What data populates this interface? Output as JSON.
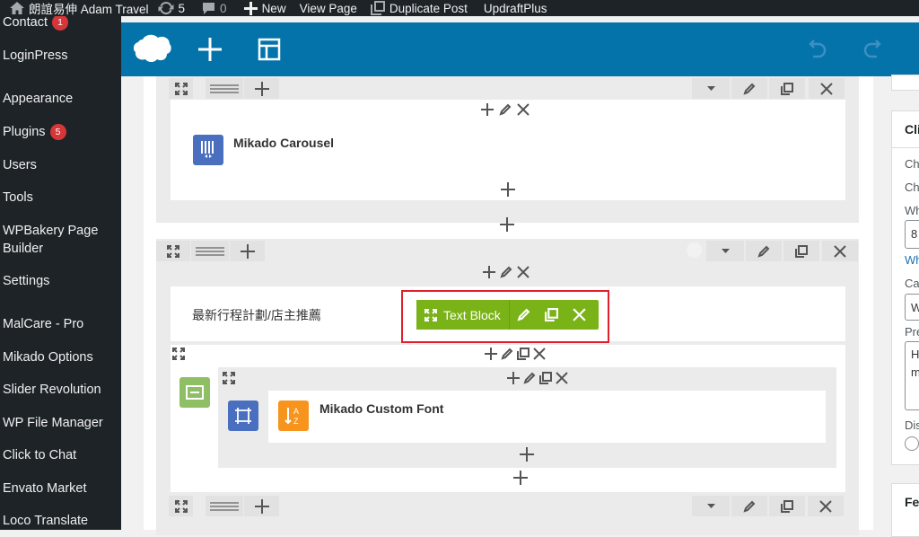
{
  "admin_bar": {
    "site_name": "朗誼易伸 Adam Travel",
    "updates_count": "5",
    "comments_count": "0",
    "new_label": "New",
    "view_page_label": "View Page",
    "duplicate_label": "Duplicate Post",
    "updraft_label": "UpdraftPlus"
  },
  "sidebar": {
    "items": [
      {
        "label": "Contact",
        "badge": "1"
      },
      {
        "label": "LoginPress"
      },
      {
        "label": "Appearance"
      },
      {
        "label": "Plugins",
        "badge": "5"
      },
      {
        "label": "Users"
      },
      {
        "label": "Tools"
      },
      {
        "label": "WPBakery Page",
        "label2": "Builder"
      },
      {
        "label": "Settings"
      },
      {
        "label": "MalCare - Pro"
      },
      {
        "label": "Mikado Options"
      },
      {
        "label": "Slider Revolution"
      },
      {
        "label": "WP File Manager"
      },
      {
        "label": "Click to Chat"
      },
      {
        "label": "Envato Market"
      },
      {
        "label": "Loco Translate"
      }
    ]
  },
  "editor": {
    "rows": [
      {
        "element": "Mikado Carousel"
      },
      {
        "text_block": "最新行程計劃/店主推薦",
        "controls_label": "Text Block",
        "nested_element": "Mikado Custom Font"
      }
    ]
  },
  "right_panel": {
    "box1_title": "Cli",
    "lines": [
      "Ch",
      "Ch",
      "Wh",
      "8",
      "Wh",
      "Ca",
      "W",
      "Pre",
      "H",
      "m",
      "Dis"
    ],
    "box2_title": "Fe"
  },
  "colors": {
    "admin_bar": "#1d2327",
    "toolbar": "#0473aa",
    "text_block_controls": "#7ab317",
    "highlight": "#e0202c",
    "carousel_icon": "#4a6fbf",
    "font_icon": "#f7941d",
    "row_icon": "#8fbf64"
  }
}
